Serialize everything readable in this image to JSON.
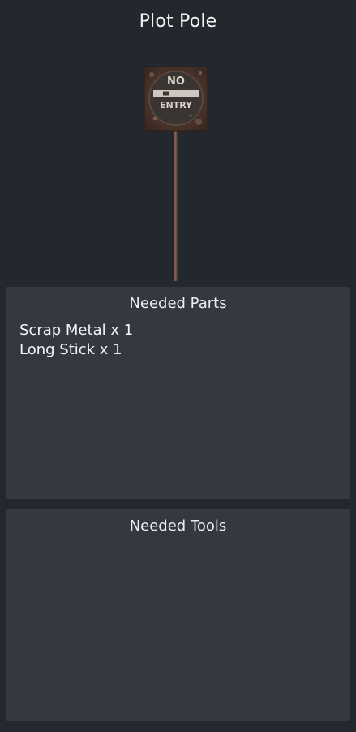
{
  "item": {
    "title": "Plot Pole",
    "sign_text_top": "NO",
    "sign_text_bottom": "ENTRY"
  },
  "parts_panel": {
    "header": "Needed Parts",
    "items": [
      "Scrap Metal x 1",
      "Long Stick x 1"
    ]
  },
  "tools_panel": {
    "header": "Needed Tools",
    "items": []
  },
  "colors": {
    "background": "#23282f",
    "panel": "#343941",
    "text": "#f2f2f2"
  }
}
